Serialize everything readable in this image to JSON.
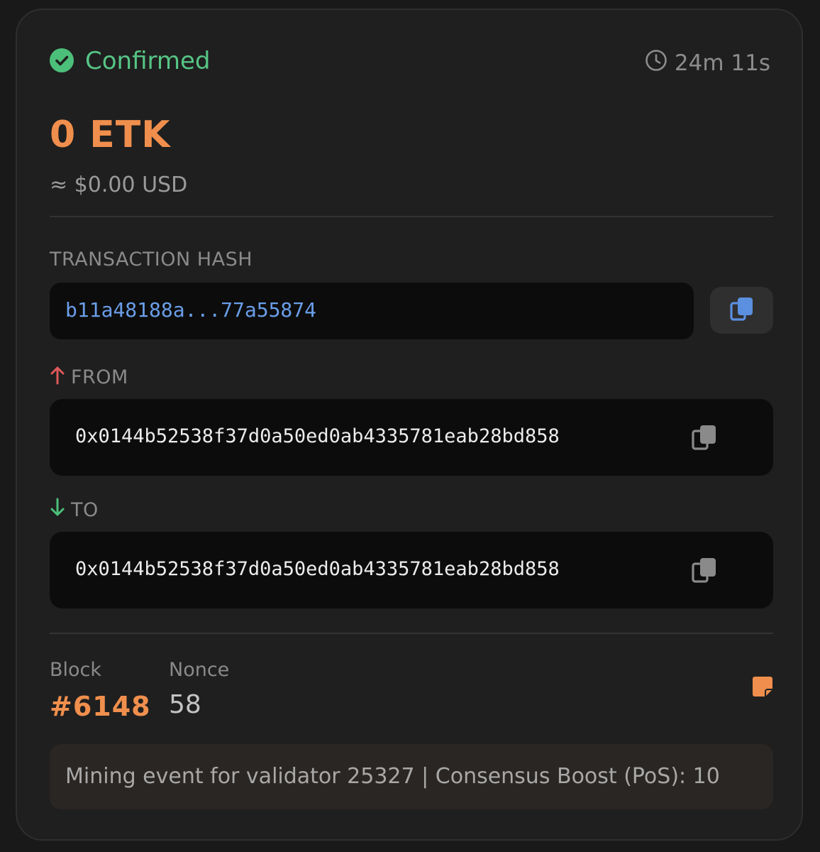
{
  "status": {
    "label": "Confirmed",
    "icon": "check-circle-icon",
    "color": "#4cc07a"
  },
  "age": {
    "icon": "clock-icon",
    "text": "24m 11s"
  },
  "amount": {
    "value": "0 ETK",
    "usd": "≈ $0.00 USD",
    "color": "#f08f4d"
  },
  "hash": {
    "label": "TRANSACTION HASH",
    "value": "b11a48188a...77a55874",
    "copy_icon": "copy-icon",
    "color": "#6a9ee8"
  },
  "from": {
    "label": "FROM",
    "icon": "arrow-up-icon",
    "address": "0x0144b52538f37d0a50ed0ab4335781eab28bd858",
    "copy_icon": "copy-icon"
  },
  "to": {
    "label": "TO",
    "icon": "arrow-down-icon",
    "address": "0x0144b52538f37d0a50ed0ab4335781eab28bd858",
    "copy_icon": "copy-icon"
  },
  "meta": {
    "block_label": "Block",
    "block_value": "#6148",
    "nonce_label": "Nonce",
    "nonce_value": "58",
    "note_icon": "sticky-note-icon"
  },
  "memo": {
    "text": "Mining event for validator 25327 | Consensus Boost (PoS): 10"
  }
}
